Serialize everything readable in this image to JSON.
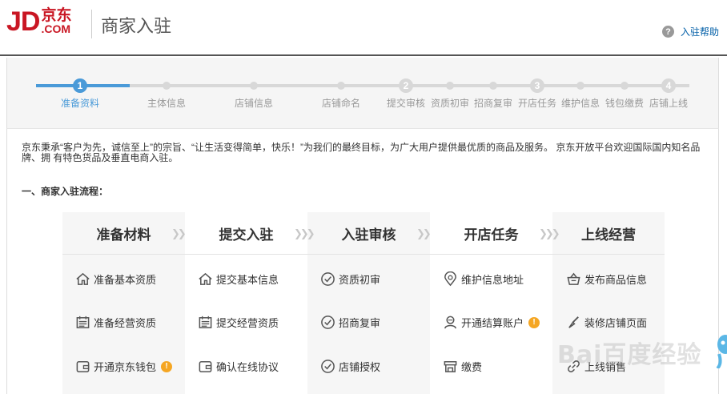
{
  "header": {
    "logo_jd": "JD",
    "logo_cn": "京东",
    "logo_com": ".COM",
    "site_title": "商家入驻",
    "help_icon": "question-circle-icon",
    "help_label": "入驻帮助"
  },
  "progress": {
    "current_step": 1,
    "steps": [
      {
        "label": "准备资料",
        "number": "1",
        "major": true
      },
      {
        "label": "主体信息",
        "number": "",
        "major": false
      },
      {
        "label": "店铺信息",
        "number": "",
        "major": false
      },
      {
        "label": "店铺命名",
        "number": "",
        "major": false
      },
      {
        "label": "提交审核",
        "number": "2",
        "major": true
      },
      {
        "label": "资质初审",
        "number": "",
        "major": false
      },
      {
        "label": "招商复审",
        "number": "",
        "major": false
      },
      {
        "label": "开店任务",
        "number": "3",
        "major": true
      },
      {
        "label": "维护信息",
        "number": "",
        "major": false
      },
      {
        "label": "钱包缴费",
        "number": "",
        "major": false
      },
      {
        "label": "店铺上线",
        "number": "4",
        "major": true
      }
    ]
  },
  "intro": "京东秉承“客户为先，诚信至上”的宗旨、“让生活变得简单，快乐！”为我们的最终目标，为广大用户提供最优质的商品及服务。 京东开放平台欢迎国际国内知名品牌、拥 有特色货品及垂直电商入驻。",
  "section_title": "一、商家入驻流程：",
  "flow": {
    "columns": [
      {
        "title": "准备材料",
        "items": [
          {
            "label": "准备基本资质",
            "icon": "home-icon",
            "badge": ""
          },
          {
            "label": "准备经营资质",
            "icon": "calendar-icon",
            "badge": ""
          },
          {
            "label": "开通京东钱包",
            "icon": "wallet-icon",
            "badge": "!"
          }
        ]
      },
      {
        "title": "提交入驻",
        "items": [
          {
            "label": "提交基本信息",
            "icon": "home-icon",
            "badge": ""
          },
          {
            "label": "提交经营资质",
            "icon": "calendar-icon",
            "badge": ""
          },
          {
            "label": "确认在线协议",
            "icon": "wallet-icon",
            "badge": ""
          }
        ]
      },
      {
        "title": "入驻审核",
        "items": [
          {
            "label": "资质初审",
            "icon": "check-circle-icon",
            "badge": ""
          },
          {
            "label": "招商复审",
            "icon": "check-circle-icon",
            "badge": ""
          },
          {
            "label": "店铺授权",
            "icon": "check-circle-icon",
            "badge": ""
          }
        ]
      },
      {
        "title": "开店任务",
        "items": [
          {
            "label": "维护信息地址",
            "icon": "location-pin-icon",
            "badge": ""
          },
          {
            "label": "开通结算账户",
            "icon": "user-icon",
            "badge": "!"
          },
          {
            "label": "缴费",
            "icon": "store-icon",
            "badge": ""
          }
        ]
      },
      {
        "title": "上线经营",
        "items": [
          {
            "label": "发布商品信息",
            "icon": "basket-icon",
            "badge": ""
          },
          {
            "label": "装修店铺页面",
            "icon": "brush-icon",
            "badge": ""
          },
          {
            "label": "上线销售",
            "icon": "link-icon",
            "badge": ""
          }
        ]
      }
    ],
    "arrow_glyph": "❯❯❯"
  },
  "watermark": "Bai百度经验",
  "colors": {
    "brand_red": "#c91623",
    "progress_blue": "#4a9ad8",
    "badge_orange": "#f5a623",
    "help_link": "#005ea7"
  }
}
